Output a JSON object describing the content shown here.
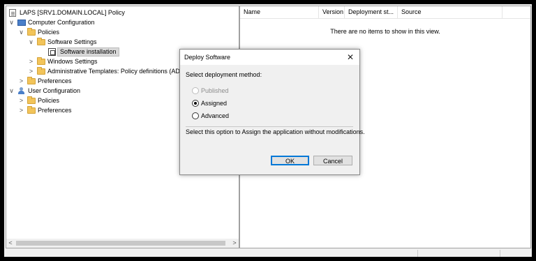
{
  "tree": {
    "root": "LAPS [SRV1.DOMAIN.LOCAL] Policy",
    "computer_configuration": "Computer Configuration",
    "policies": "Policies",
    "software_settings": "Software Settings",
    "software_installation": "Software installation",
    "windows_settings": "Windows Settings",
    "administrative_templates": "Administrative Templates: Policy definitions (AD",
    "preferences": "Preferences",
    "user_configuration": "User Configuration",
    "user_policies": "Policies",
    "user_preferences": "Preferences"
  },
  "list": {
    "columns": [
      "Name",
      "Version",
      "Deployment st...",
      "Source"
    ],
    "empty_message": "There are no items to show in this view."
  },
  "dialog": {
    "title": "Deploy Software",
    "close_glyph": "✕",
    "prompt": "Select deployment method:",
    "options": [
      {
        "label": "Published",
        "disabled": true,
        "selected": false
      },
      {
        "label": "Assigned",
        "disabled": false,
        "selected": true
      },
      {
        "label": "Advanced",
        "disabled": false,
        "selected": false
      }
    ],
    "description": "Select this option to Assign the application without modifications.",
    "ok_label": "OK",
    "cancel_label": "Cancel"
  },
  "scrollbar": {
    "left_arrow": "<",
    "right_arrow": ">"
  },
  "chevrons": {
    "expanded": "∨",
    "collapsed": ">"
  }
}
